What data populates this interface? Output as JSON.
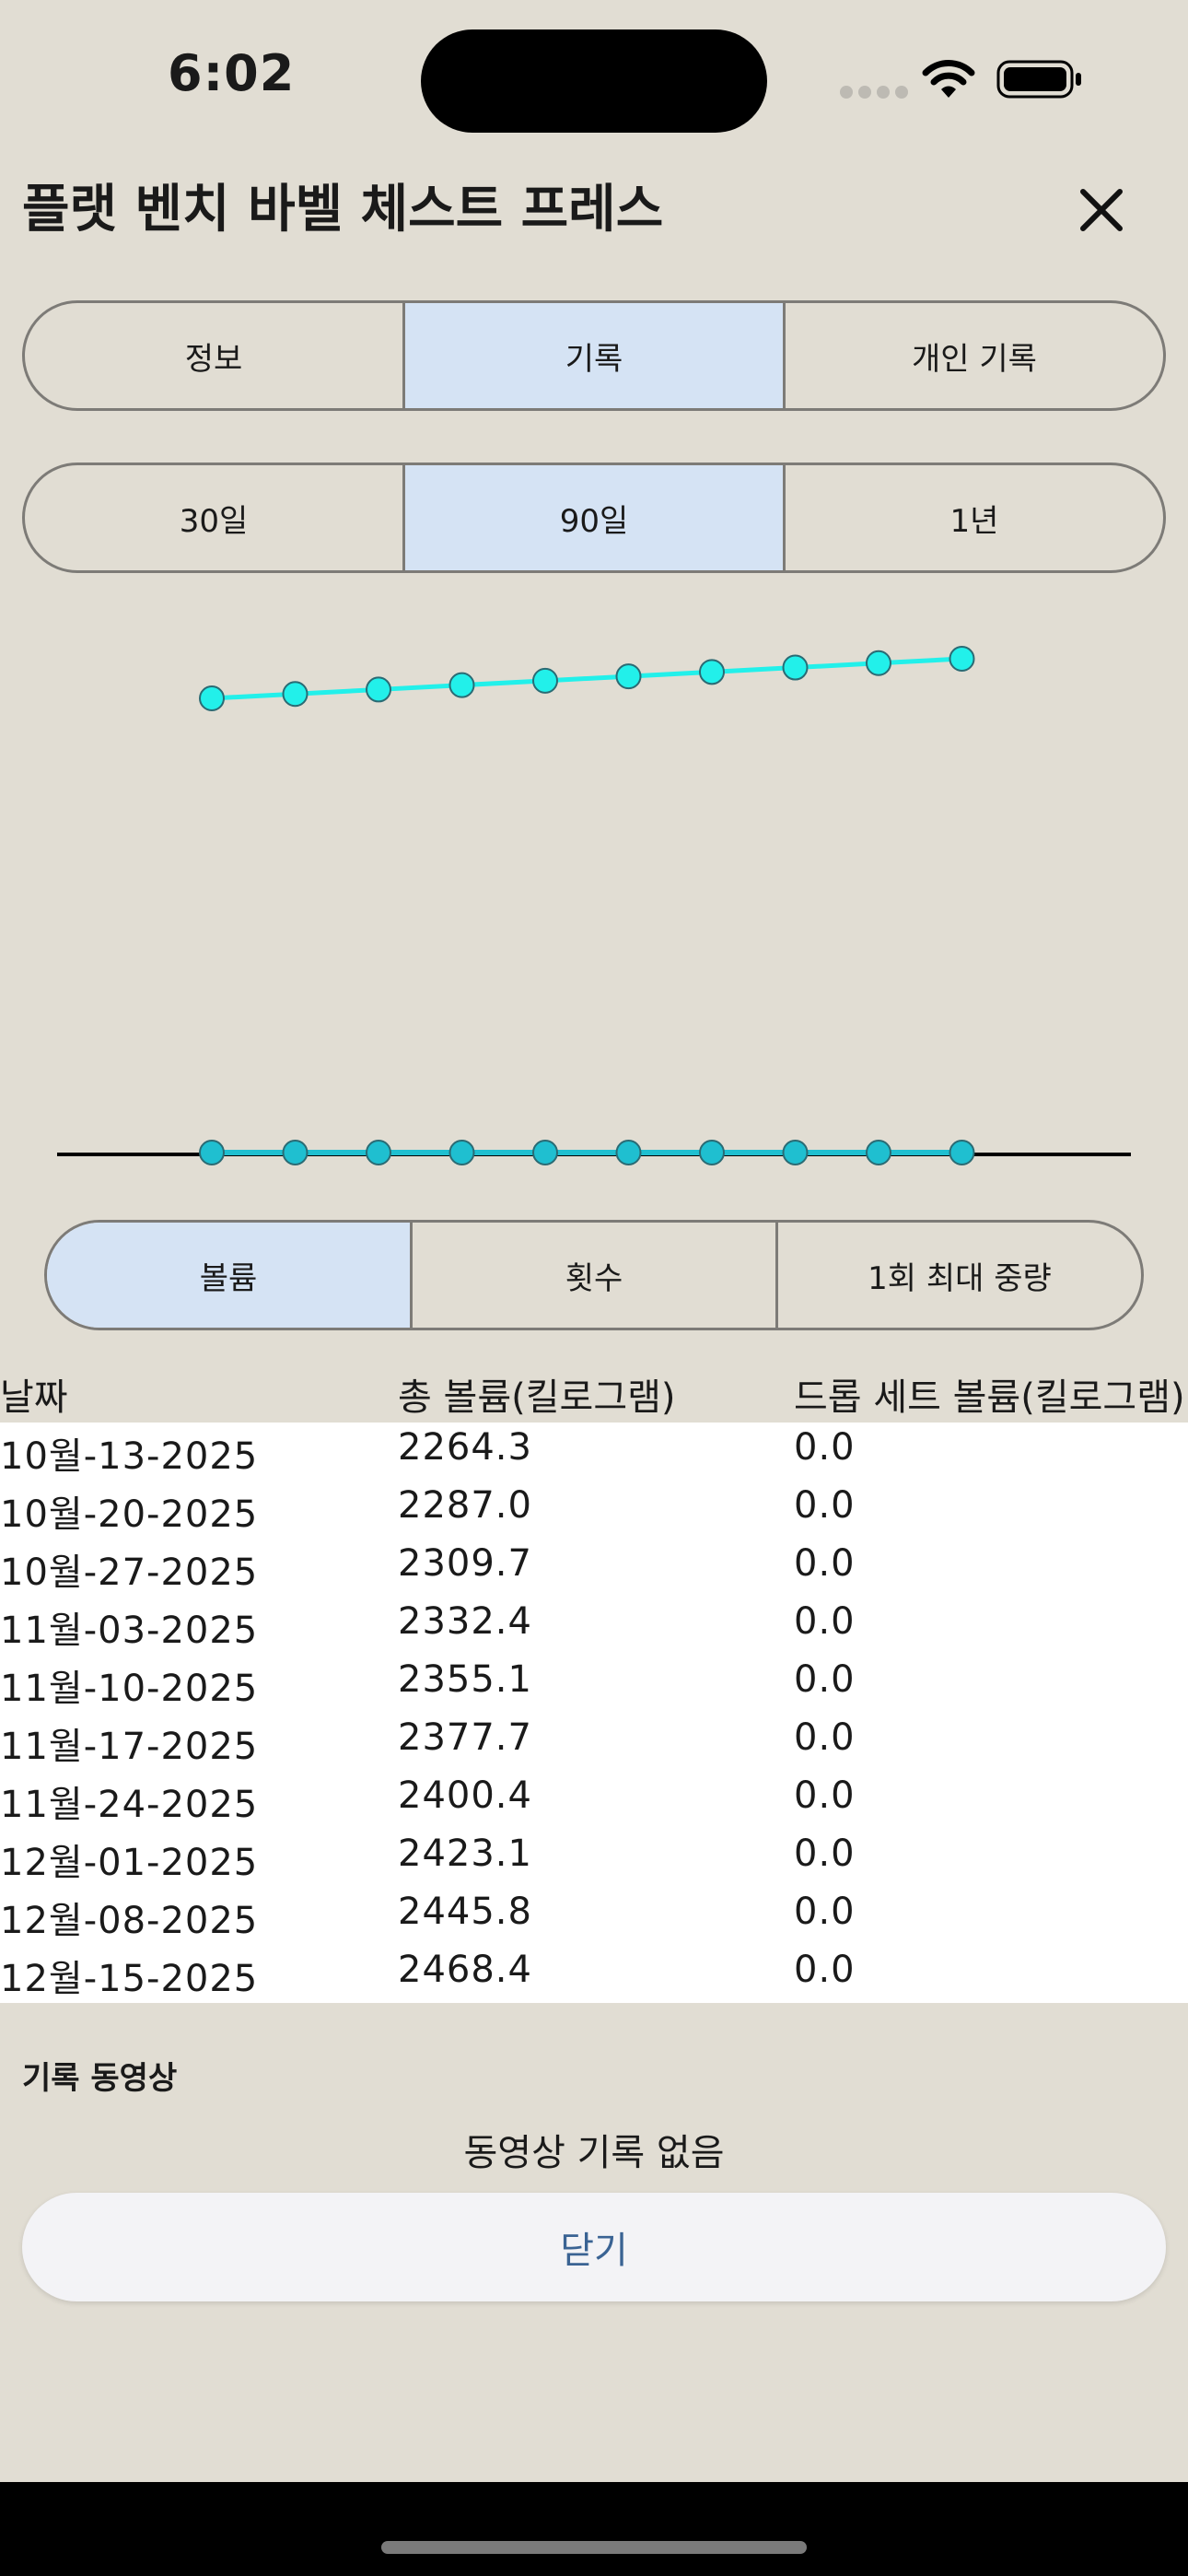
{
  "status_bar": {
    "time": "6:02"
  },
  "header": {
    "title": "플랫 벤치 바벨 체스트 프레스"
  },
  "tabs": {
    "items": [
      {
        "label": "정보",
        "active": false
      },
      {
        "label": "기록",
        "active": true
      },
      {
        "label": "개인 기록",
        "active": false
      }
    ]
  },
  "ranges": {
    "items": [
      {
        "label": "30일",
        "active": false
      },
      {
        "label": "90일",
        "active": true
      },
      {
        "label": "1년",
        "active": false
      }
    ]
  },
  "metrics": {
    "items": [
      {
        "label": "볼륨",
        "active": true
      },
      {
        "label": "횟수",
        "active": false
      },
      {
        "label": "1회 최대 중량",
        "active": false
      }
    ]
  },
  "colors": {
    "background": "#e1ddd3",
    "selected_segment": "#d5e3f4",
    "series_main": "#22f0ea",
    "series_drop": "#1fbfd0",
    "close_text": "#3a6393"
  },
  "chart_data": {
    "type": "line",
    "x": [
      "10월-13-2025",
      "10월-20-2025",
      "10월-27-2025",
      "11월-03-2025",
      "11월-10-2025",
      "11월-17-2025",
      "11월-24-2025",
      "12월-01-2025",
      "12월-08-2025",
      "12월-15-2025"
    ],
    "series": [
      {
        "values": [
          2264.3,
          2287.0,
          2309.7,
          2332.4,
          2355.1,
          2377.7,
          2400.4,
          2423.1,
          2445.8,
          2468.4
        ]
      },
      {
        "values": [
          0.0,
          0.0,
          0.0,
          0.0,
          0.0,
          0.0,
          0.0,
          0.0,
          0.0,
          0.0
        ]
      }
    ],
    "grid": false,
    "legend": "none"
  },
  "table": {
    "headers": [
      "날짜",
      "총 볼륨(킬로그램)",
      "드롭 세트 볼륨(킬로그램)"
    ],
    "rows": [
      [
        "10월-13-2025",
        "2264.3",
        "0.0"
      ],
      [
        "10월-20-2025",
        "2287.0",
        "0.0"
      ],
      [
        "10월-27-2025",
        "2309.7",
        "0.0"
      ],
      [
        "11월-03-2025",
        "2332.4",
        "0.0"
      ],
      [
        "11월-10-2025",
        "2355.1",
        "0.0"
      ],
      [
        "11월-17-2025",
        "2377.7",
        "0.0"
      ],
      [
        "11월-24-2025",
        "2400.4",
        "0.0"
      ],
      [
        "12월-01-2025",
        "2423.1",
        "0.0"
      ],
      [
        "12월-08-2025",
        "2445.8",
        "0.0"
      ],
      [
        "12월-15-2025",
        "2468.4",
        "0.0"
      ]
    ]
  },
  "videos": {
    "heading": "기록 동영상",
    "empty": "동영상 기록 없음"
  },
  "footer": {
    "close_label": "닫기"
  },
  "icons": {
    "close": "close-icon",
    "wifi": "wifi-icon",
    "battery": "battery-icon",
    "signal": "signal-icon"
  }
}
